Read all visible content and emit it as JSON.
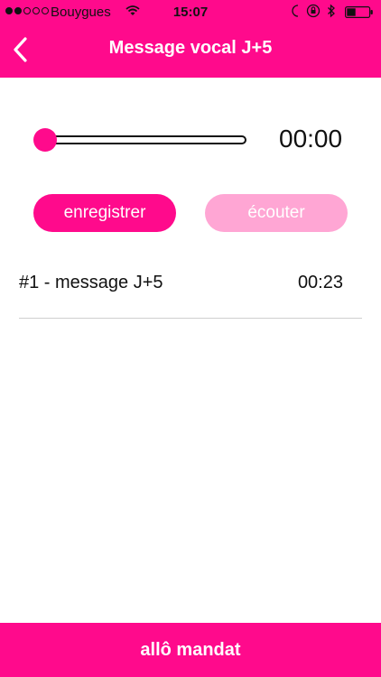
{
  "status_bar": {
    "carrier": "Bouygues",
    "time": "15:07",
    "signal_bars": 5,
    "signal_filled": 2,
    "icons": [
      "wifi-icon",
      "moon-icon",
      "rotation-lock-icon",
      "bluetooth-icon",
      "battery-icon"
    ],
    "battery_level": 0.4
  },
  "nav": {
    "title": "Message vocal J+5",
    "back_icon": "chevron-left-icon"
  },
  "player": {
    "progress": 0,
    "duration": "00:00"
  },
  "buttons": {
    "record_label": "enregistrer",
    "listen_label": "écouter"
  },
  "recordings": [
    {
      "label": "#1 - message J+5",
      "duration": "00:23"
    }
  ],
  "footer": {
    "label": "allô mandat"
  },
  "colors": {
    "accent": "#ff0a8c",
    "accent_light": "#ffa6d4"
  }
}
